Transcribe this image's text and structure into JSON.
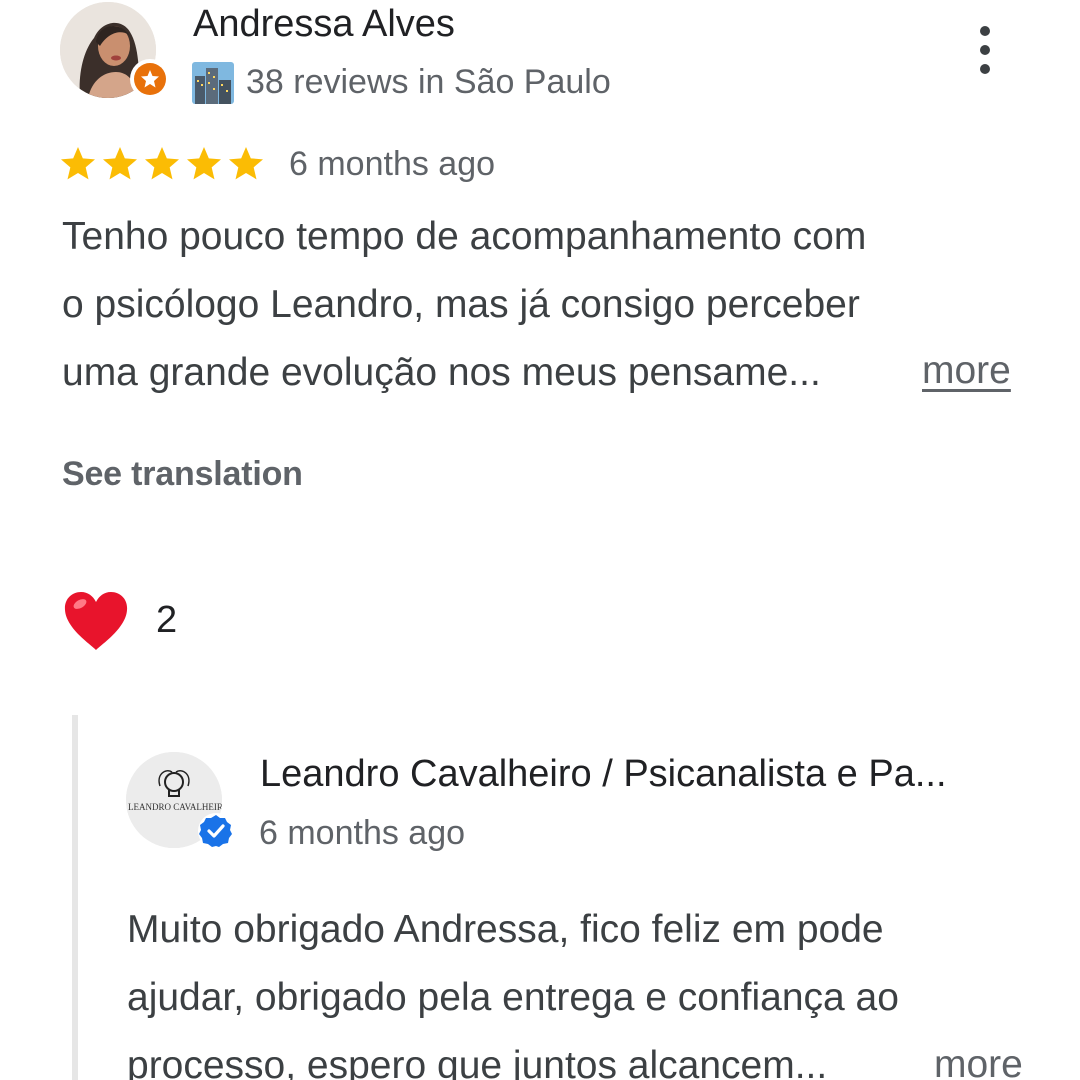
{
  "review": {
    "author_name": "Andressa Alves",
    "author_meta": "38 reviews in São Paulo",
    "rating": 5,
    "rating_max": 5,
    "date": "6 months ago",
    "text_lines": [
      "Tenho pouco tempo de acompanhamento com",
      "o psicólogo Leandro, mas já consigo perceber",
      "uma grande evolução nos meus pensame..."
    ],
    "more_label": "more",
    "see_translation_label": "See translation",
    "reaction_count": "2",
    "icons": {
      "avatar": "user-photo",
      "badge": "local-guide-badge-icon",
      "meta": "city-buildings-icon",
      "menu": "more-vert-icon",
      "reaction": "heart-icon"
    },
    "colors": {
      "star": "#fbbc04",
      "guide_badge": "#e8710a",
      "heart": "#e8142c"
    }
  },
  "reply": {
    "owner_name": "Leandro Cavalheiro / Psicanalista e Pa...",
    "date": "6 months ago",
    "text_lines": [
      "Muito obrigado Andressa, fico feliz em pode",
      "ajudar, obrigado pela entrega e confiança ao",
      "processo, espero que juntos alcancem..."
    ],
    "more_label": "more",
    "icons": {
      "avatar": "business-logo",
      "verified": "verified-check-icon"
    },
    "colors": {
      "verified": "#1a73e8"
    }
  }
}
